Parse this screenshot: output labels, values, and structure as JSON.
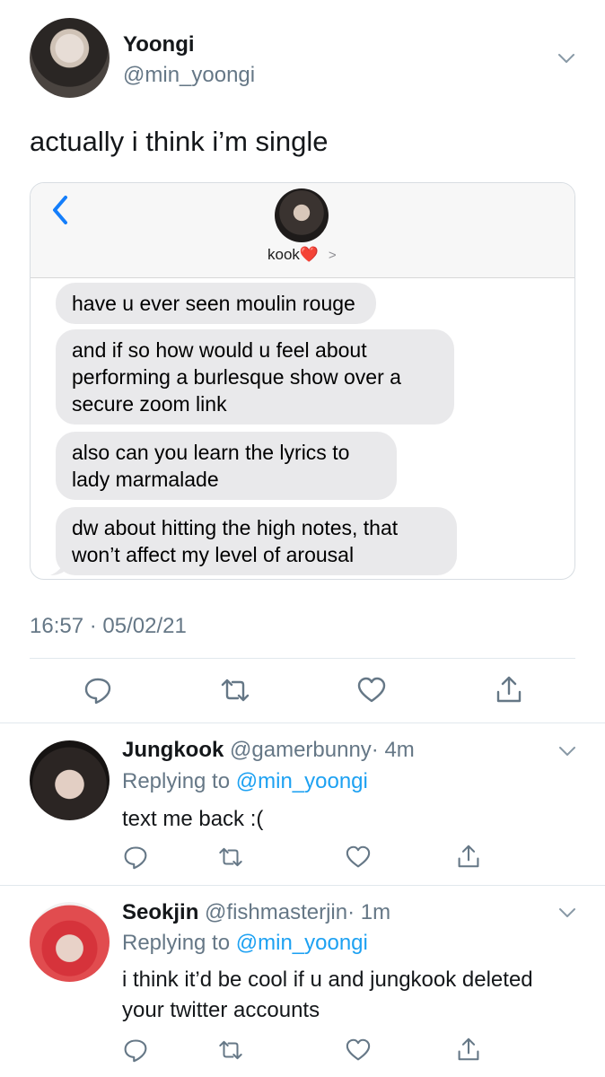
{
  "tweet": {
    "author_name": "Yoongi",
    "author_handle": "@min_yoongi",
    "text": "actually i think i’m single",
    "timestamp": "16:57 · 05/02/21"
  },
  "imessage": {
    "contact_name": "kook❤️",
    "contact_chevron": ">",
    "messages": [
      "have u ever seen moulin rouge",
      "and if so how would u feel about performing a burlesque show over a secure zoom link",
      "also can you learn the lyrics to lady marmalade",
      "dw about hitting the high notes, that won’t affect my level of arousal"
    ]
  },
  "replies": [
    {
      "name": "Jungkook",
      "handle": "@gamerbunny",
      "time": "· 4m",
      "replying_label": "Replying to",
      "replying_to": "@min_yoongi",
      "text": "text me back :("
    },
    {
      "name": "Seokjin",
      "handle": "@fishmasterjin",
      "time": "· 1m",
      "replying_label": "Replying to",
      "replying_to": "@min_yoongi",
      "text": "i think it’d be cool if u and jungkook deleted your twitter accounts"
    }
  ],
  "icons": {
    "reply": "speech-bubble-icon",
    "retweet": "retweet-icon",
    "like": "heart-icon",
    "share": "share-icon",
    "more": "chevron-down-icon"
  },
  "colors": {
    "text": "#14171a",
    "secondary": "#657786",
    "link": "#1da1f2",
    "imessage_back": "#147efb",
    "bubble": "#e9e9eb"
  }
}
